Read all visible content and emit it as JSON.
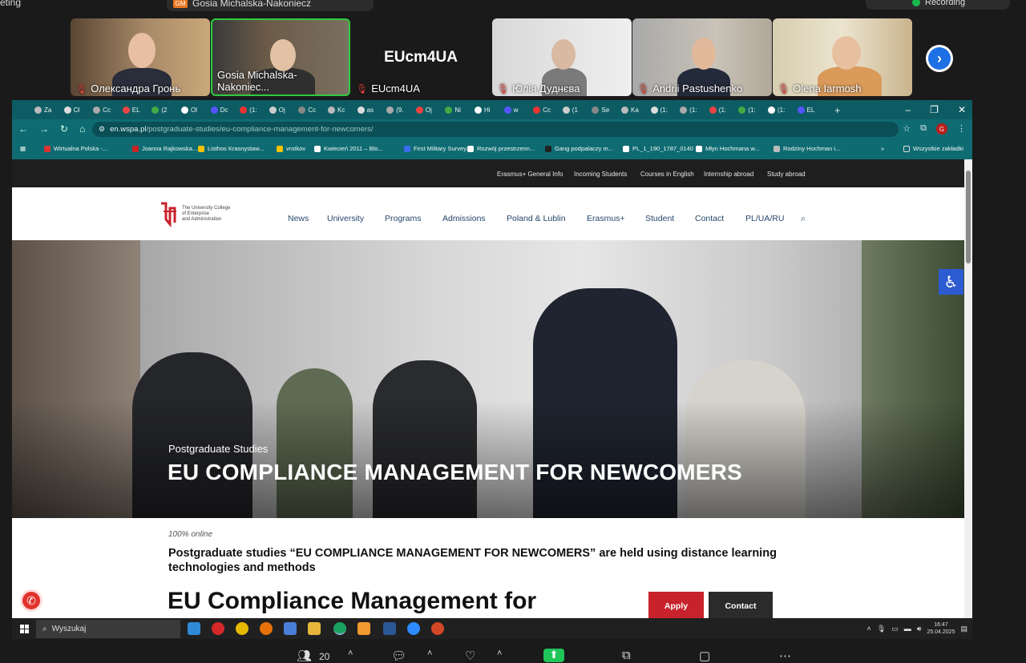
{
  "zoom": {
    "meeting_label": "eting",
    "sharer_badge": "GM",
    "sharer_name": "Gosia Michalska-Nakoniecz",
    "recording_label": "Recording",
    "participants_count": "20",
    "participants": [
      {
        "name": "Олександра Гронь"
      },
      {
        "name": "Gosia Michalska-Nakoniec..."
      },
      {
        "name": "EUcm4UA",
        "display": "EUcm4UA"
      },
      {
        "name": "Юлія Дуднєва"
      },
      {
        "name": "Andrii Pastushenko"
      },
      {
        "name": "Olena Iarmosh"
      }
    ]
  },
  "browser": {
    "tabs": [
      "Za",
      "Cł",
      "Cc",
      "EL",
      "(2",
      "Ol",
      "Dc",
      "(1:",
      "Oj",
      "Cc",
      "Kc",
      "as",
      "(9.",
      "Oj",
      "Ni",
      "Hi",
      "w",
      "Cc",
      "(1",
      "Se",
      "Ka",
      "(1:",
      "(1:",
      "(1:",
      "(1:",
      "(1:",
      "EL"
    ],
    "url_host": "en.wspa.pl",
    "url_path": "/postgraduate-studies/eu-compliance-management-for-newcomers/",
    "avatar_letter": "G",
    "bookmarks": [
      "Wirtualna Polska -...",
      "Joanna Rajkowska....",
      "Listhos Krasnystaw...",
      "vrotkov",
      "Kwiecień 2011 – Blo...",
      "First Military Survey...",
      "Rozwój przestrzenn...",
      "Gang podpalaczy m...",
      "PL_1_190_1787_0140",
      "Młyn Hochmana w...",
      "Rodziny Hochman i..."
    ],
    "bookmarks_folder": "Wszystkie zakładki",
    "colors": {
      "chrome": "#0f6b72",
      "tabbar": "#0d5c63"
    }
  },
  "site": {
    "utility_links": [
      "Erasmus+ General Info",
      "Incoming Students",
      "Courses in English",
      "Internship abroad",
      "Study abroad"
    ],
    "logo_lines": [
      "The University College",
      "of Enterprise",
      "and Administration"
    ],
    "nav": [
      "News",
      "University",
      "Programs",
      "Admissions",
      "Poland & Lublin",
      "Erasmus+",
      "Student",
      "Contact",
      "PL/UA/RU"
    ],
    "hero_subtitle": "Postgraduate Studies",
    "hero_title": "EU COMPLIANCE MANAGEMENT FOR NEWCOMERS",
    "online_label": "100% online",
    "intro": "Postgraduate studies “EU COMPLIANCE MANAGEMENT FOR NEWCOMERS” are held using distance learning technologies and methods",
    "big_title": "EU Compliance Management for",
    "apply_label": "Apply",
    "contact_label": "Contact",
    "colors": {
      "accent": "#c8222c",
      "nav": "#26466b"
    }
  },
  "taskbar": {
    "search_label": "Wyszukaj",
    "time": "16:47",
    "date": "25.04.2025"
  }
}
